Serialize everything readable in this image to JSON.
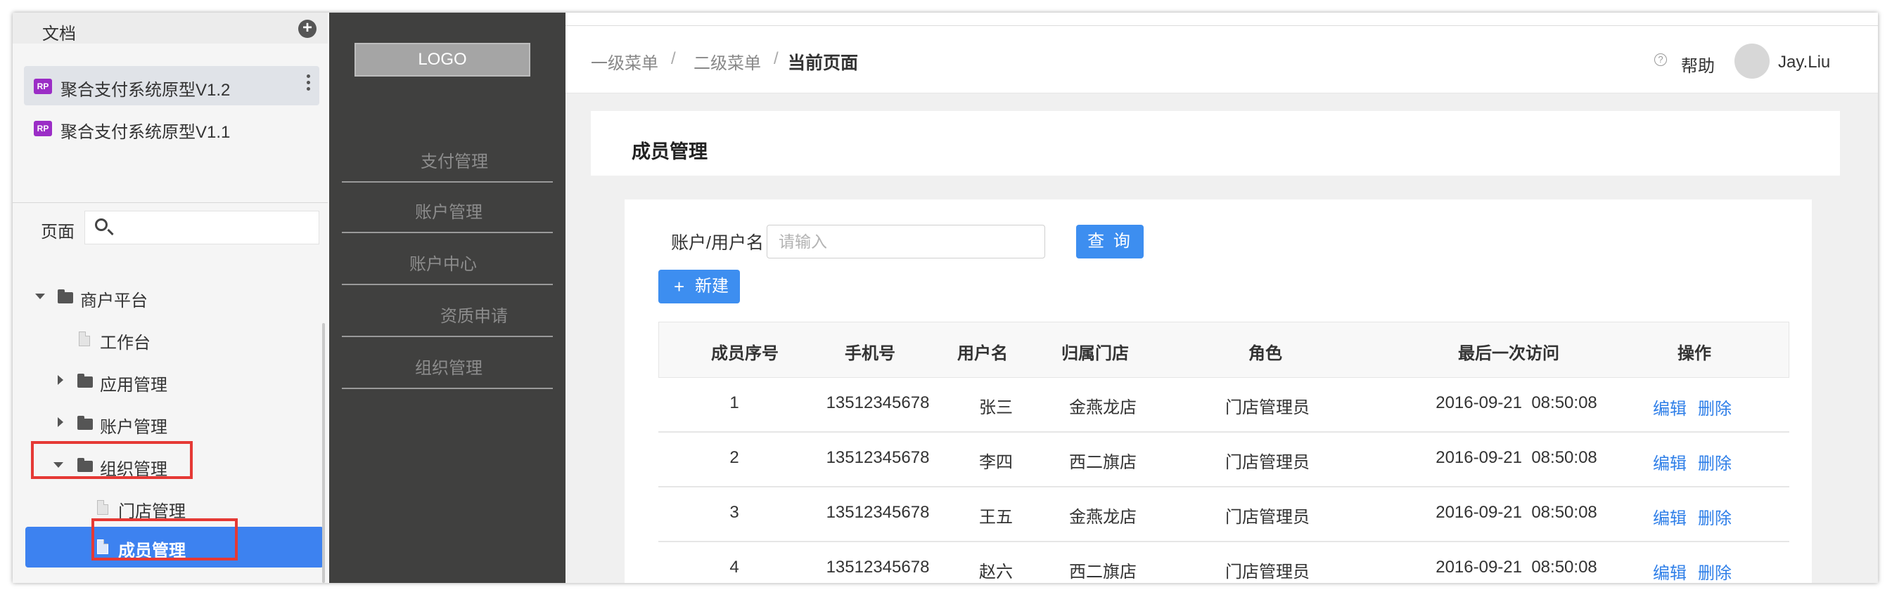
{
  "left_panel": {
    "docs_title": "文档",
    "docs": [
      {
        "badge": "RP",
        "name": "聚合支付系统原型V1.2"
      },
      {
        "badge": "RP",
        "name": "聚合支付系统原型V1.1"
      }
    ],
    "pages_label": "页面",
    "search_placeholder": "",
    "tree": [
      {
        "label": "商户平台",
        "type": "folder",
        "state": "expanded"
      },
      {
        "label": "工作台",
        "type": "page"
      },
      {
        "label": "应用管理",
        "type": "folder",
        "state": "collapsed"
      },
      {
        "label": "账户管理",
        "type": "folder",
        "state": "collapsed"
      },
      {
        "label": "组织管理",
        "type": "folder",
        "state": "expanded"
      },
      {
        "label": "门店管理",
        "type": "page"
      },
      {
        "label": "成员管理",
        "type": "page",
        "selected": true
      }
    ]
  },
  "prototype": {
    "logo": "LOGO",
    "nav": [
      "支付管理",
      "账户管理",
      "账户中心",
      "资质申请",
      "组织管理"
    ],
    "breadcrumb": [
      "一级菜单",
      "二级菜单",
      "当前页面"
    ],
    "breadcrumb_sep": "/",
    "help": "帮助",
    "help_icon": "?",
    "user": "Jay.Liu",
    "page_title": "成员管理",
    "filter": {
      "label": "账户/用户名",
      "placeholder": "请输入",
      "value": ""
    },
    "query_button": "查 询",
    "new_button": {
      "icon": "+",
      "label": "新建"
    },
    "table": {
      "headers": [
        "成员序号",
        "手机号",
        "用户名",
        "归属门店",
        "角色",
        "最后一次访问",
        "操作"
      ],
      "rows": [
        {
          "id": "1",
          "phone": "13512345678",
          "name": "张三",
          "store": "金燕龙店",
          "role": "门店管理员",
          "last": "2016-09-21  08:50:08",
          "edit": "编辑",
          "del": "删除"
        },
        {
          "id": "2",
          "phone": "13512345678",
          "name": "李四",
          "store": "西二旗店",
          "role": "门店管理员",
          "last": "2016-09-21  08:50:08",
          "edit": "编辑",
          "del": "删除"
        },
        {
          "id": "3",
          "phone": "13512345678",
          "name": "王五",
          "store": "金燕龙店",
          "role": "门店管理员",
          "last": "2016-09-21  08:50:08",
          "edit": "编辑",
          "del": "删除"
        },
        {
          "id": "4",
          "phone": "13512345678",
          "name": "赵六",
          "store": "西二旗店",
          "role": "门店管理员",
          "last": "2016-09-21  08:50:08",
          "edit": "编辑",
          "del": "删除"
        }
      ]
    }
  },
  "colors": {
    "accent": "#3d8ef0",
    "selection": "#3d82f0",
    "highlight_box": "#e53935",
    "sidebar_dark": "#40403f"
  }
}
